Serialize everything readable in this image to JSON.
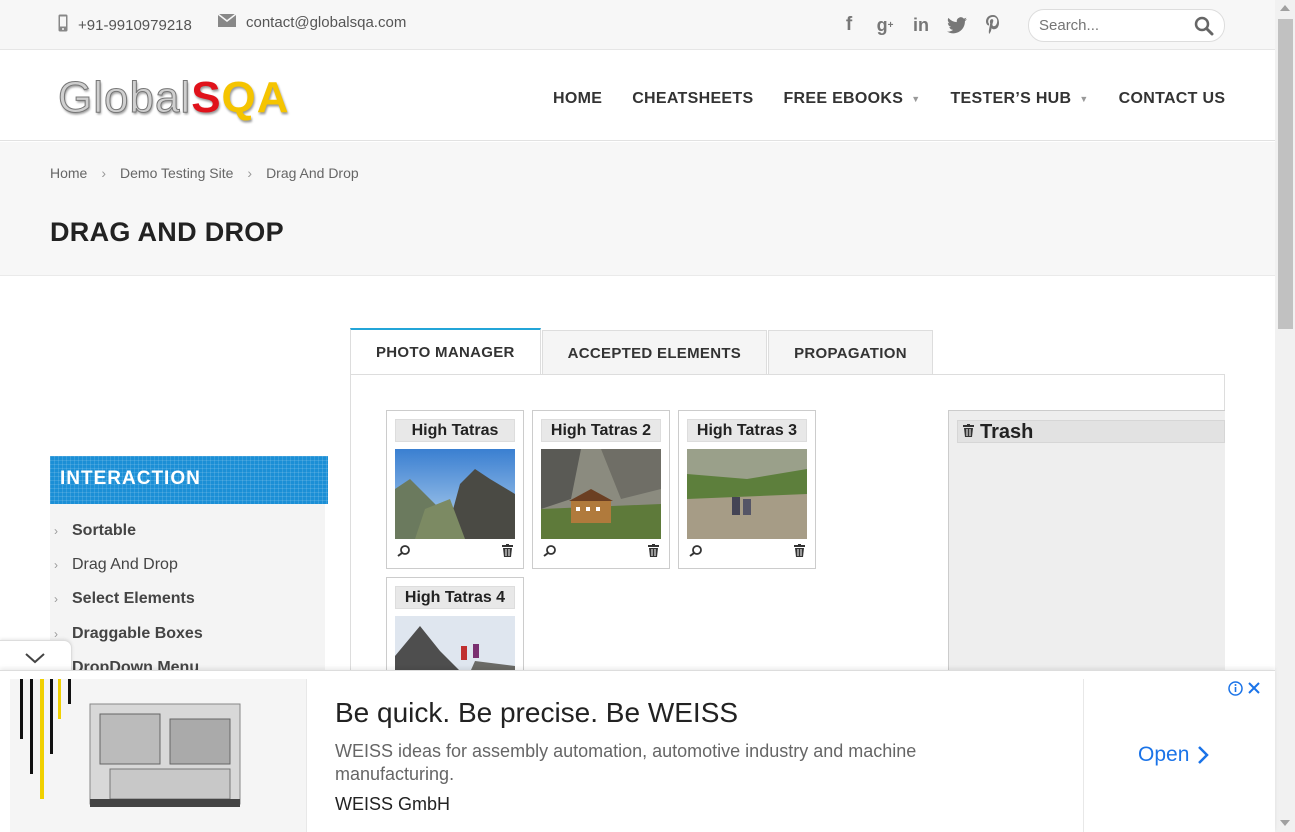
{
  "topbar": {
    "phone": "+91-9910979218",
    "email": "contact@globalsqa.com",
    "social": [
      "facebook-icon",
      "google-plus-icon",
      "linkedin-icon",
      "twitter-icon",
      "pinterest-icon"
    ],
    "search_placeholder": "Search..."
  },
  "header": {
    "logo_part1": "Global",
    "logo_part2": "S",
    "logo_part3": "QA",
    "nav": [
      "HOME",
      "CHEATSHEETS",
      "FREE EBOOKS",
      "TESTER’S HUB",
      "CONTACT US"
    ]
  },
  "breadcrumb": [
    "Home",
    "Demo Testing Site",
    "Drag And Drop"
  ],
  "page_title": "DRAG AND DROP",
  "sidebar": {
    "title": "INTERACTION",
    "items": [
      "Sortable",
      "Drag And Drop",
      "Select Elements",
      "Draggable Boxes",
      "DropDown Menu"
    ]
  },
  "tabs": [
    "PHOTO MANAGER",
    "ACCEPTED ELEMENTS",
    "PROPAGATION"
  ],
  "gallery": [
    "High Tatras",
    "High Tatras 2",
    "High Tatras 3",
    "High Tatras 4"
  ],
  "trash_title": "Trash",
  "ad": {
    "title": "Be quick. Be precise. Be WEISS",
    "description": "WEISS ideas for assembly automation, automotive industry and machine manufacturing.",
    "brand": "WEISS GmbH",
    "cta": "Open"
  },
  "colors": {
    "accent": "#1b8fd6",
    "tab_active_border": "#23a5d8",
    "logo_red": "#e0121b",
    "logo_yellow": "#f5c400",
    "ad_link": "#1a73e8"
  }
}
